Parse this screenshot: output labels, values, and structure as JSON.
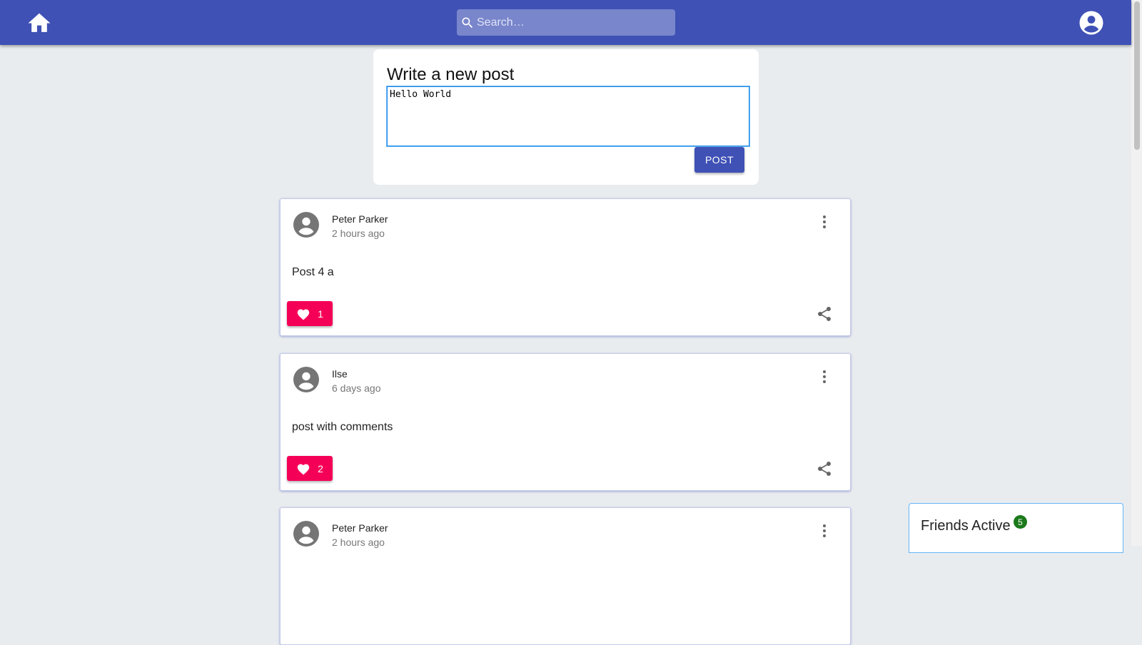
{
  "header": {
    "search_placeholder": "Search…"
  },
  "composer": {
    "title": "Write a new post",
    "text": "Hello World",
    "post_label": "POST"
  },
  "posts": [
    {
      "author": "Peter Parker",
      "time": "2 hours ago",
      "content": "Post 4 a",
      "likes": "1"
    },
    {
      "author": "Ilse",
      "time": "6 days ago",
      "content": "post with comments",
      "likes": "2"
    },
    {
      "author": "Peter Parker",
      "time": "2 hours ago",
      "content": "",
      "likes": ""
    }
  ],
  "friends": {
    "title": "Friends Active",
    "count": "5"
  },
  "icons": {
    "home": "home-icon",
    "search": "search-icon",
    "account": "account-circle-icon",
    "avatar": "account-circle-icon",
    "more": "more-vert-icon",
    "like": "heart-icon",
    "share": "share-icon"
  },
  "colors": {
    "appbar": "#3f51b5",
    "search_bg": "#7986cb",
    "like": "#f50057",
    "badge": "#1b7a1b",
    "background": "#e9ecef"
  }
}
